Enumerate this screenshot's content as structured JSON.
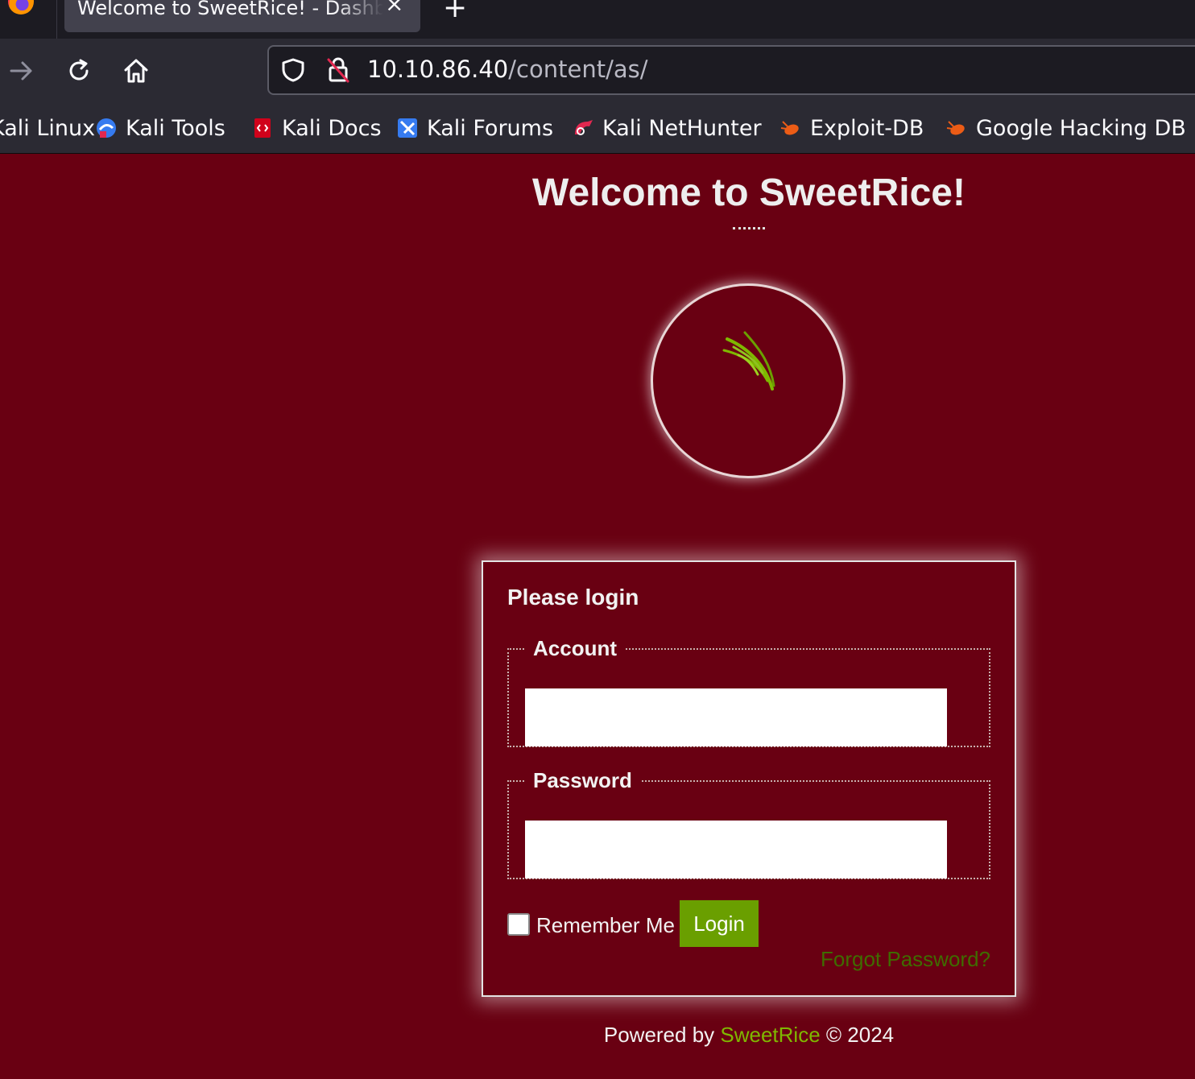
{
  "browser": {
    "tab_title": "Welcome to SweetRice! - Dashboard",
    "close_symbol": "×",
    "new_tab_symbol": "+",
    "url_host": "10.10.86.40",
    "url_path": "/content/as/",
    "bookmarks": [
      {
        "label": "Kali Linux",
        "icon": "kali-icon"
      },
      {
        "label": "Kali Tools",
        "icon": "kali-tools-icon"
      },
      {
        "label": "Kali Docs",
        "icon": "kali-docs-icon"
      },
      {
        "label": "Kali Forums",
        "icon": "kali-forums-icon"
      },
      {
        "label": "Kali NetHunter",
        "icon": "nethunter-icon"
      },
      {
        "label": "Exploit-DB",
        "icon": "exploit-db-icon"
      },
      {
        "label": "Google Hacking DB",
        "icon": "ghdb-icon"
      }
    ]
  },
  "page": {
    "title": "Welcome to SweetRice!",
    "login": {
      "heading": "Please login",
      "account_legend": "Account",
      "account_value": "",
      "password_legend": "Password",
      "password_value": "",
      "remember_label": "Remember Me",
      "login_button": "Login",
      "forgot_link": "Forgot Password?"
    },
    "footer": {
      "prefix": "Powered by ",
      "link": "SweetRice",
      "suffix": " © 2024"
    }
  },
  "colors": {
    "background": "#690012",
    "button": "#6a9f00",
    "link": "#7fb800"
  }
}
